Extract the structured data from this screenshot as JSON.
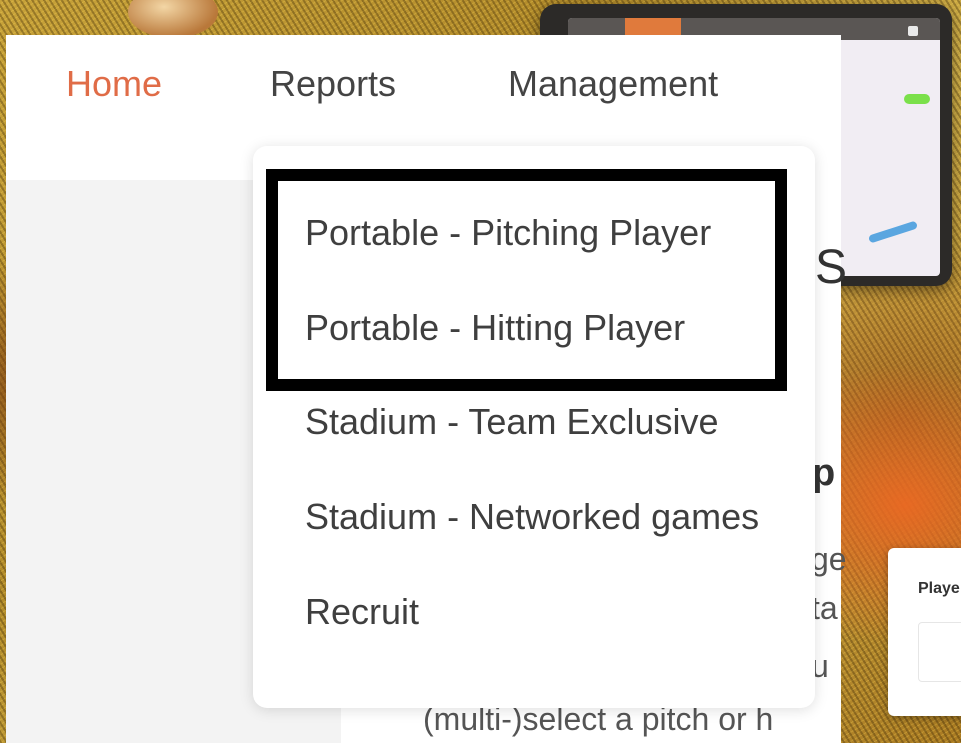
{
  "nav": {
    "items": [
      {
        "label": "Home",
        "active": true
      },
      {
        "label": "Reports",
        "active": false
      },
      {
        "label": "Management",
        "active": false
      }
    ]
  },
  "dropdown": {
    "items": [
      {
        "label": "Portable - Pitching Player"
      },
      {
        "label": "Portable - Hitting Player"
      },
      {
        "label": "Stadium - Team Exclusive"
      },
      {
        "label": "Stadium - Networked games"
      },
      {
        "label": "Recruit"
      }
    ]
  },
  "background": {
    "title_fragment": "S",
    "subtitle_fragment": "p",
    "line_fragments": [
      "ge",
      "ta",
      "u",
      "(multi-)select a pitch or h"
    ],
    "player_card_label": "Playe"
  },
  "colors": {
    "nav_active": "#e06c47",
    "nav_text": "#444444",
    "highlight_border": "#000000",
    "accent_orange": "#e07a3c"
  }
}
